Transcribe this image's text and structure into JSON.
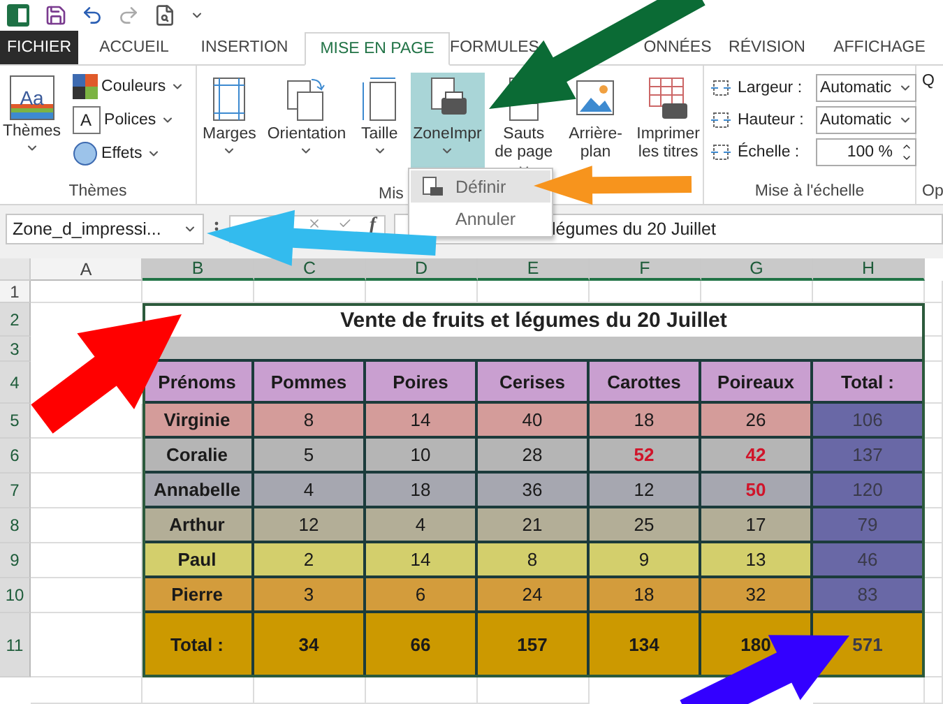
{
  "tabs": [
    {
      "label": "FICHIER",
      "kind": "file",
      "selected": false
    },
    {
      "label": "ACCUEIL",
      "kind": "tab",
      "selected": false
    },
    {
      "label": "INSERTION",
      "kind": "tab",
      "selected": false
    },
    {
      "label": "MISE EN PAGE",
      "kind": "tab",
      "selected": true
    },
    {
      "label": "FORMULES",
      "kind": "tab",
      "selected": false
    },
    {
      "label": "ONNÉES",
      "kind": "tab",
      "selected": false
    },
    {
      "label": "RÉVISION",
      "kind": "tab",
      "selected": false
    },
    {
      "label": "AFFICHAGE",
      "kind": "tab",
      "selected": false
    }
  ],
  "ribbon": {
    "themes_group": {
      "label": "Thèmes",
      "main_button": "Thèmes",
      "main_icon_text": "Aa",
      "items": [
        {
          "label": "Couleurs",
          "kind": "colors"
        },
        {
          "label": "Polices",
          "kind": "fonts",
          "icon_text": "A"
        },
        {
          "label": "Effets",
          "kind": "effects"
        }
      ]
    },
    "page_setup_group": {
      "label": "Mis",
      "buttons": [
        {
          "label": "Marges",
          "kind": "margins",
          "dropdown": true,
          "selected": false
        },
        {
          "label": "Orientation",
          "kind": "orientation",
          "dropdown": true,
          "selected": false
        },
        {
          "label": "Taille",
          "kind": "size",
          "dropdown": true,
          "selected": false
        },
        {
          "label": "ZoneImpr",
          "kind": "print-area",
          "dropdown": true,
          "selected": true
        },
        {
          "label": "Sauts de page",
          "kind": "breaks",
          "dropdown": true,
          "selected": false
        },
        {
          "label": "Arrière-plan",
          "kind": "background",
          "dropdown": false,
          "selected": false
        },
        {
          "label": "Imprimer les titres",
          "kind": "titles",
          "dropdown": false,
          "selected": false
        }
      ]
    },
    "scale_group": {
      "label": "Mise à l'échelle",
      "fields": [
        {
          "label": "Largeur :",
          "value": "Automatic",
          "kind": "select"
        },
        {
          "label": "Hauteur :",
          "value": "Automatic",
          "kind": "select"
        },
        {
          "label": "Échelle :",
          "value": "100 %",
          "kind": "spin"
        }
      ]
    },
    "options_group": {
      "label": "Op",
      "heading": "Q"
    }
  },
  "dropdown_menu": [
    {
      "label": "Définir",
      "selected": true
    },
    {
      "label": "Annuler",
      "selected": false
    }
  ],
  "formula_bar": {
    "name_box": "Zone_d_impressi...",
    "function_label": "f",
    "formula": "légumes du 20 Juillet"
  },
  "columns": [
    {
      "label": "A",
      "selected": false
    },
    {
      "label": "B",
      "selected": true
    },
    {
      "label": "C",
      "selected": true
    },
    {
      "label": "D",
      "selected": true
    },
    {
      "label": "E",
      "selected": true
    },
    {
      "label": "F",
      "selected": true
    },
    {
      "label": "G",
      "selected": true
    },
    {
      "label": "H",
      "selected": true
    }
  ],
  "rows": [
    {
      "label": "1",
      "selected": false
    },
    {
      "label": "2",
      "selected": true
    },
    {
      "label": "3",
      "selected": true
    },
    {
      "label": "4",
      "selected": true
    },
    {
      "label": "5",
      "selected": true
    },
    {
      "label": "6",
      "selected": true
    },
    {
      "label": "7",
      "selected": true
    },
    {
      "label": "8",
      "selected": true
    },
    {
      "label": "9",
      "selected": true
    },
    {
      "label": "10",
      "selected": true
    },
    {
      "label": "11",
      "selected": true
    }
  ],
  "table": {
    "title": "Vente de fruits et légumes du 20 Juillet",
    "headers": [
      "Prénoms",
      "Pommes",
      "Poires",
      "Cerises",
      "Carottes",
      "Poireaux",
      "Total :"
    ],
    "rows": [
      {
        "name": "Virginie",
        "color": "#d49c9a",
        "values": [
          {
            "text": "8",
            "alert": false
          },
          {
            "text": "14",
            "alert": false
          },
          {
            "text": "40",
            "alert": false
          },
          {
            "text": "18",
            "alert": false
          },
          {
            "text": "26",
            "alert": false
          }
        ],
        "total": "106"
      },
      {
        "name": "Coralie",
        "color": "#b5b5b5",
        "values": [
          {
            "text": "5",
            "alert": false
          },
          {
            "text": "10",
            "alert": false
          },
          {
            "text": "28",
            "alert": false
          },
          {
            "text": "52",
            "alert": true
          },
          {
            "text": "42",
            "alert": true
          }
        ],
        "total": "137"
      },
      {
        "name": "Annabelle",
        "color": "#a6a7b0",
        "values": [
          {
            "text": "4",
            "alert": false
          },
          {
            "text": "18",
            "alert": false
          },
          {
            "text": "36",
            "alert": false
          },
          {
            "text": "12",
            "alert": false
          },
          {
            "text": "50",
            "alert": true
          }
        ],
        "total": "120"
      },
      {
        "name": "Arthur",
        "color": "#b3ae97",
        "values": [
          {
            "text": "12",
            "alert": false
          },
          {
            "text": "4",
            "alert": false
          },
          {
            "text": "21",
            "alert": false
          },
          {
            "text": "25",
            "alert": false
          },
          {
            "text": "17",
            "alert": false
          }
        ],
        "total": "79"
      },
      {
        "name": "Paul",
        "color": "#d3cf6c",
        "values": [
          {
            "text": "2",
            "alert": false
          },
          {
            "text": "14",
            "alert": false
          },
          {
            "text": "8",
            "alert": false
          },
          {
            "text": "9",
            "alert": false
          },
          {
            "text": "13",
            "alert": false
          }
        ],
        "total": "46"
      },
      {
        "name": "Pierre",
        "color": "#d39c3c",
        "values": [
          {
            "text": "3",
            "alert": false
          },
          {
            "text": "6",
            "alert": false
          },
          {
            "text": "24",
            "alert": false
          },
          {
            "text": "18",
            "alert": false
          },
          {
            "text": "32",
            "alert": false
          }
        ],
        "total": "83"
      }
    ],
    "total_row": {
      "label": "Total :",
      "values": [
        "34",
        "66",
        "157",
        "134",
        "180"
      ],
      "grand_total": "571"
    }
  },
  "arrows": [
    {
      "color": "#0b6b35"
    },
    {
      "color": "#f7941d"
    },
    {
      "color": "#33bbee"
    },
    {
      "color": "#ff0000"
    },
    {
      "color": "#3300ff"
    }
  ]
}
